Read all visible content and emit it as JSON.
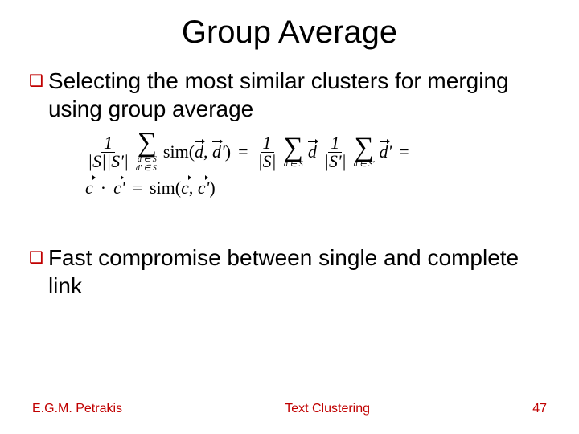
{
  "title": "Group Average",
  "bullets": {
    "b1": "Selecting the most similar clusters for merging using group average",
    "b2": "Fast compromise between single and complete link"
  },
  "formula": {
    "frac1_num": "1",
    "frac1_den": "|S||S'|",
    "sum1_under_a": "d ∈ S",
    "sum1_under_b": "d' ∈ S'",
    "sim_dd": "sim(d, d')",
    "eq": "=",
    "frac2_num": "1",
    "frac2_den": "|S|",
    "sum2_under": "d ∈ S",
    "d_term": "d",
    "frac3_num": "1",
    "frac3_den": "|S'|",
    "sum3_under": "d ∈ S'",
    "dprime_term": "d'",
    "trail_eq": "=",
    "line2_lhs_c": "c",
    "line2_dot": "·",
    "line2_lhs_cp": "c'",
    "line2_eq": "=",
    "line2_rhs": "sim(c, c')"
  },
  "footer": {
    "author": "E.G.M. Petrakis",
    "center": "Text Clustering",
    "page": "47"
  }
}
